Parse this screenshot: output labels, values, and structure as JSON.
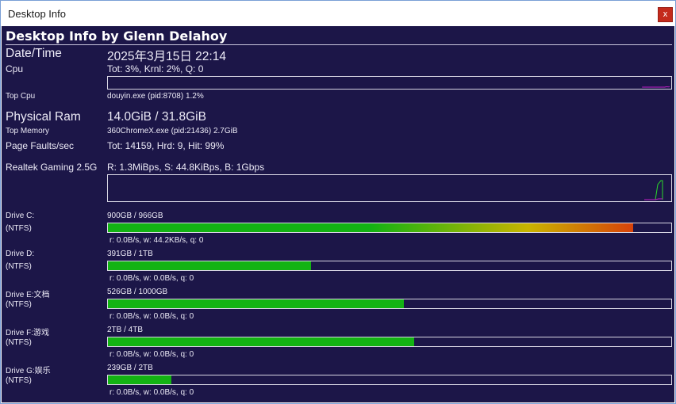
{
  "window": {
    "title": "Desktop Info",
    "close_glyph": "x"
  },
  "header": "Desktop Info by Glenn Delahoy",
  "datetime": {
    "label": "Date/Time",
    "value": "2025年3月15日 22:14"
  },
  "cpu": {
    "label": "Cpu",
    "value": "Tot:  3%, Krnl:  2%, Q: 0",
    "history_percent": [
      0,
      0,
      0,
      0,
      0,
      0,
      0,
      0,
      0,
      0,
      0,
      0,
      0,
      0,
      0,
      0,
      0,
      0,
      0,
      0,
      0,
      0,
      0,
      0,
      0,
      3,
      3,
      3,
      2,
      4
    ],
    "graph_color": "#c21fc7"
  },
  "top_cpu": {
    "label": "Top Cpu",
    "value": "douyin.exe (pid:8708) 1.2%"
  },
  "physical_ram": {
    "label": "Physical Ram",
    "value": "14.0GiB / 31.8GiB"
  },
  "top_memory": {
    "label": "Top Memory",
    "value": "360ChromeX.exe (pid:21436) 2.7GiB"
  },
  "page_faults": {
    "label": "Page Faults/sec",
    "value": "Tot: 14159, Hrd: 9, Hit: 99%"
  },
  "network": {
    "label": "Realtek Gaming 2.5G",
    "value": "R: 1.3MiBps, S: 44.8KiBps, B: 1Gbps",
    "send_color": "#c21fc7",
    "recv_color": "#2bd82b"
  },
  "drives": [
    {
      "label": "Drive C:",
      "fs": "(NTFS)",
      "usage": "900GB / 966GB",
      "fill_percent": 93.2,
      "io": "r: 0.0B/s, w: 44.2KB/s, q: 0",
      "gradient": true
    },
    {
      "label": "Drive D:",
      "fs": "(NTFS)",
      "usage": "391GB / 1TB",
      "fill_percent": 36.1,
      "io": "r: 0.0B/s, w: 0.0B/s, q: 0",
      "gradient": false
    },
    {
      "label": "Drive E:文档",
      "fs": "(NTFS)",
      "usage": "526GB / 1000GB",
      "fill_percent": 52.6,
      "io": "r: 0.0B/s, w: 0.0B/s, q: 0",
      "gradient": false
    },
    {
      "label": "Drive F:游戏",
      "fs": "(NTFS)",
      "usage": "2TB / 4TB",
      "fill_percent": 54.3,
      "io": "r: 0.0B/s, w: 0.0B/s, q: 0",
      "gradient": false
    },
    {
      "label": "Drive G:娱乐",
      "fs": "(NTFS)",
      "usage": "239GB / 2TB",
      "fill_percent": 11.2,
      "io": "r: 0.0B/s, w: 0.0B/s, q: 0",
      "gradient": false
    }
  ],
  "colors": {
    "background": "#1c1648",
    "bar_green": "#13b313",
    "bar_warn": "#c8b400",
    "bar_critical": "#d8420a"
  }
}
